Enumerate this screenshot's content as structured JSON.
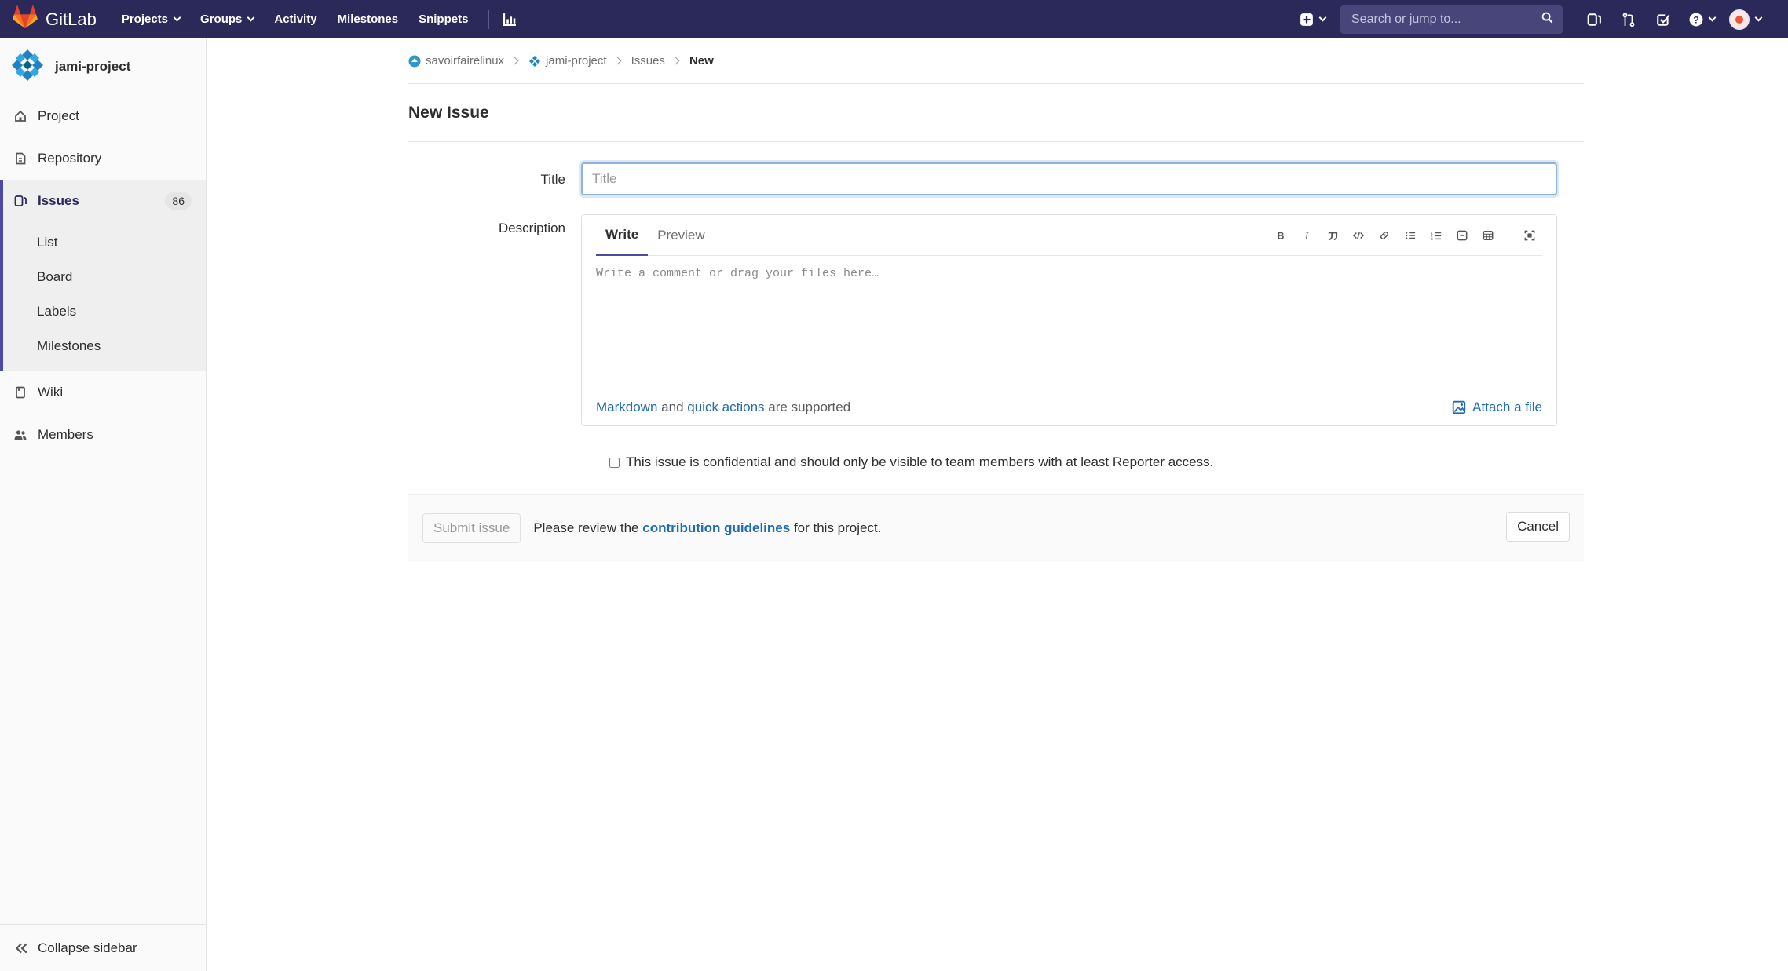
{
  "navbar": {
    "brand": "GitLab",
    "links": [
      "Projects",
      "Groups",
      "Activity",
      "Milestones",
      "Snippets"
    ],
    "search_placeholder": "Search or jump to...",
    "icons": [
      "plus-square-icon",
      "search-icon",
      "issues-icon",
      "merge-request-icon",
      "todo-icon",
      "help-icon",
      "avatar"
    ],
    "bg_color": "#2b2959"
  },
  "sidebar": {
    "project_name": "jami-project",
    "items": [
      {
        "label": "Project",
        "icon": "home-icon"
      },
      {
        "label": "Repository",
        "icon": "repository-icon"
      },
      {
        "label": "Issues",
        "icon": "issues-icon",
        "badge": "86",
        "active": true
      },
      {
        "label": "Wiki",
        "icon": "book-icon"
      },
      {
        "label": "Members",
        "icon": "users-icon"
      }
    ],
    "issue_subitems": [
      "List",
      "Board",
      "Labels",
      "Milestones"
    ],
    "collapse_label": "Collapse sidebar"
  },
  "breadcrumb": [
    "savoirfairelinux",
    "jami-project",
    "Issues",
    "New"
  ],
  "page": {
    "title": "New Issue"
  },
  "form": {
    "title_label": "Title",
    "title_placeholder": "Title",
    "title_value": "",
    "description_label": "Description",
    "tabs": [
      "Write",
      "Preview"
    ],
    "toolbar": [
      "bold-icon",
      "italic-icon",
      "quote-icon",
      "code-icon",
      "link-icon",
      "bullet-list-icon",
      "numbered-list-icon",
      "task-list-icon",
      "table-icon",
      "fullscreen-icon"
    ],
    "description_placeholder": "Write a comment or drag your files here…",
    "markdown_link": "Markdown",
    "and_text": "and",
    "quick_actions_link": "quick actions",
    "supported_text": "are supported",
    "attach_label": "Attach a file",
    "confidential_text": "This issue is confidential and should only be visible to team members with at least Reporter access.",
    "confidential_checked": false
  },
  "footer": {
    "submit_label": "Submit issue",
    "review_prefix": "Please review the",
    "guidelines_link": "contribution guidelines",
    "review_suffix": "for this project.",
    "cancel_label": "Cancel"
  },
  "colors": {
    "accent": "#4b4ba3",
    "link": "#1f6bb5"
  }
}
